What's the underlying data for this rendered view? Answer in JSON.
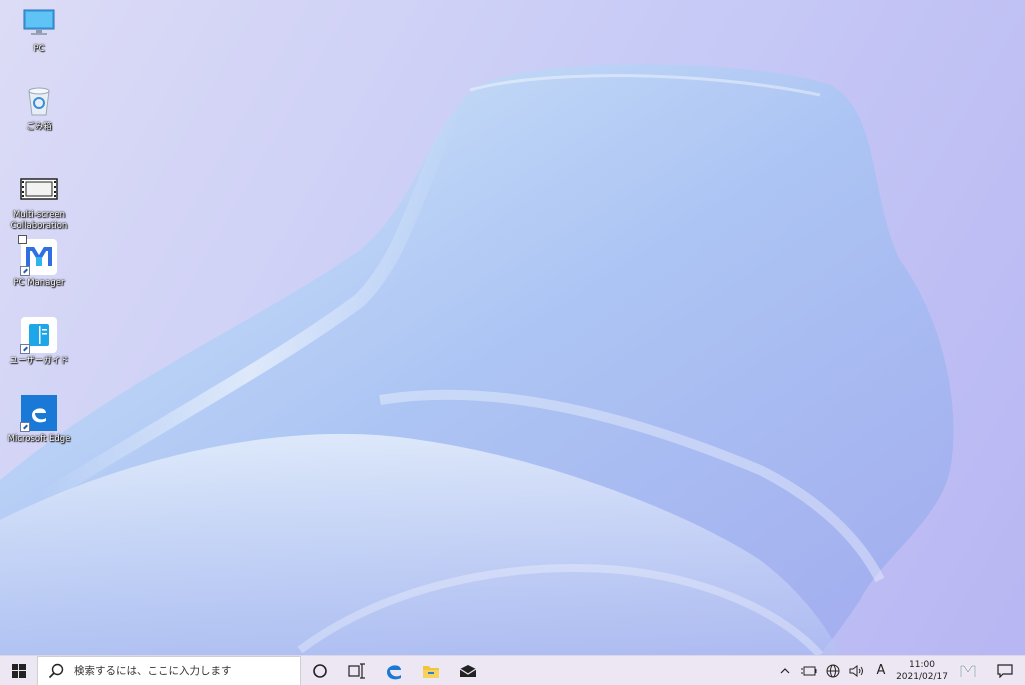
{
  "desktop_icons": [
    {
      "label": "PC",
      "icon": "pc-monitor-icon"
    },
    {
      "label": "ごみ箱",
      "icon": "recycle-bin-icon"
    },
    {
      "label": "Multi-screen Collaboration",
      "icon": "film-strip-icon"
    },
    {
      "label": "PC Manager",
      "icon": "pc-manager-logo-icon"
    },
    {
      "label": "ユーザーガイド",
      "icon": "user-guide-book-icon"
    },
    {
      "label": "Microsoft Edge",
      "icon": "edge-browser-icon"
    }
  ],
  "taskbar": {
    "search_placeholder": "検索するには、ここに入力します",
    "apps": [
      "cortana-circle-icon",
      "task-view-icon",
      "edge-icon",
      "file-explorer-icon",
      "mail-icon"
    ],
    "tray": {
      "ime_mode": "A",
      "time": "11:00",
      "date": "2021/02/17"
    }
  },
  "colors": {
    "accent_blue": "#0078d7",
    "taskbar_bg": "#ece7f2",
    "wallpaper_base": "#c9ccf6"
  }
}
